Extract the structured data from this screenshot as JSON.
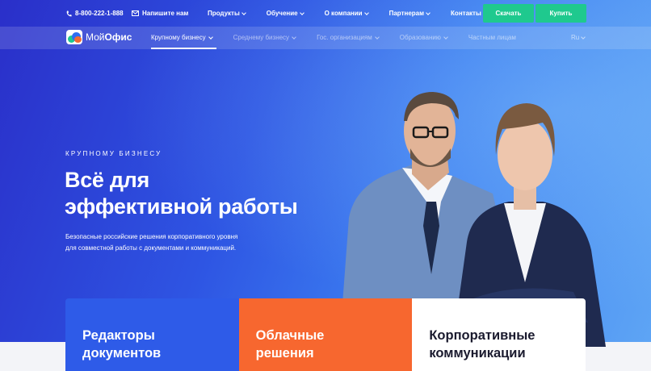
{
  "topbar": {
    "phone": "8-800-222-1-888",
    "write_label": "Напишите нам",
    "menu": [
      {
        "label": "Продукты",
        "dropdown": true
      },
      {
        "label": "Обучение",
        "dropdown": true
      },
      {
        "label": "О компании",
        "dropdown": true
      },
      {
        "label": "Партнерам",
        "dropdown": true
      },
      {
        "label": "Контакты",
        "dropdown": false
      }
    ],
    "download_label": "Скачать",
    "buy_label": "Купить"
  },
  "logo": {
    "part1": "Мой",
    "part2": "Офис"
  },
  "nav": {
    "items": [
      {
        "label": "Крупному бизнесу",
        "active": true
      },
      {
        "label": "Среднему бизнесу",
        "active": false
      },
      {
        "label": "Гос. организациям",
        "active": false
      },
      {
        "label": "Образованию",
        "active": false
      },
      {
        "label": "Частным лицам",
        "active": false
      }
    ],
    "lang": "Ru"
  },
  "hero": {
    "eyebrow": "КРУПНОМУ БИЗНЕСУ",
    "title_line1": "Всё для",
    "title_line2": "эффективной работы",
    "subtitle_line1": "Безопасные российские решения корпоративного уровня",
    "subtitle_line2": "для совместной работы с документами и коммуникаций."
  },
  "cards": [
    {
      "line1": "Редакторы",
      "line2": "документов",
      "color": "#2e5be8"
    },
    {
      "line1": "Облачные",
      "line2": "решения",
      "color": "#f7672f"
    },
    {
      "line1": "Корпоративные",
      "line2": "коммуникации",
      "color": "#ffffff"
    }
  ],
  "colors": {
    "accent_green": "#1fc98e",
    "brand_blue": "#2e5be8",
    "brand_orange": "#f7672f"
  }
}
